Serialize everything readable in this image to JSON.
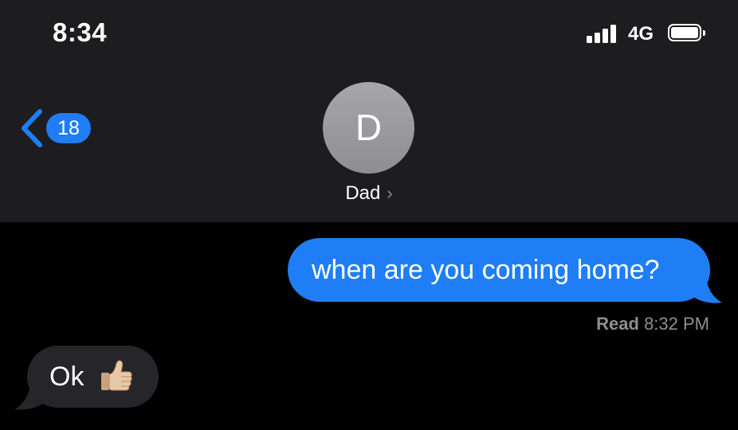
{
  "status_bar": {
    "time": "8:34",
    "network": "4G",
    "signal_bars": 4,
    "battery_level": 1.0
  },
  "nav": {
    "back_count": "18",
    "back_icon": "chevron-left-icon",
    "contact_initial": "D",
    "contact_name": "Dad",
    "contact_chevron": "›"
  },
  "messages": [
    {
      "direction": "sent",
      "text": "when are you coming home?"
    },
    {
      "direction": "received",
      "text": "Ok",
      "emoji": "thumbs-up-icon"
    }
  ],
  "receipt": {
    "label": "Read",
    "time": "8:32 PM"
  },
  "colors": {
    "header_bg": "#1d1d1f",
    "screen_bg": "#000000",
    "accent_blue": "#1f7ef6",
    "received_bubble": "#26252a",
    "avatar_gray": "#9a9a9f",
    "secondary_text": "#8e8e93"
  }
}
